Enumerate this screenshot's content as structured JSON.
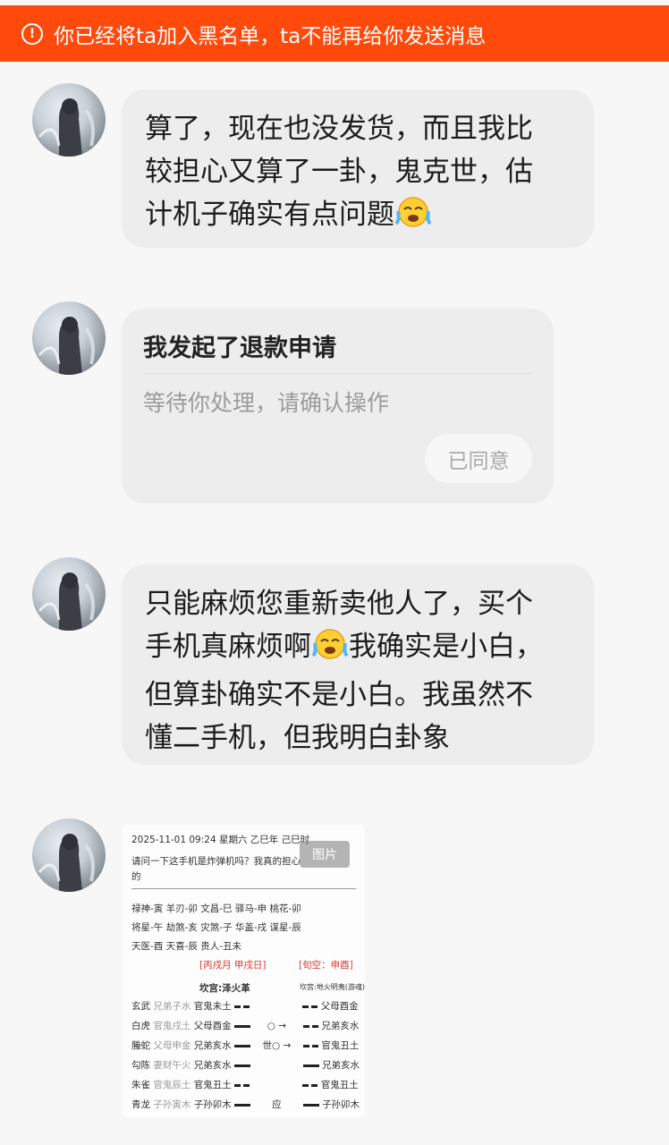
{
  "banner": {
    "text": "你已经将ta加入黑名单，ta不能再给你发送消息",
    "icon": "warning-circle-icon",
    "color": "#ff4a0c"
  },
  "messages": [
    {
      "type": "text",
      "lines": [
        "算了，现在也没发货，而且我比",
        "较担心又算了一卦，鬼克世，估",
        "计机子确实有点问题"
      ],
      "emoji": "crying-face"
    },
    {
      "type": "refund",
      "title": "我发起了退款申请",
      "subtitle": "等待你处理，请确认操作",
      "button": "已同意"
    },
    {
      "type": "text",
      "lines": [
        "只能麻烦您重新卖他人了，买个",
        "手机真麻烦啊",
        "我确实是小白，",
        "但算卦确实不是小白。我虽然不",
        "懂二手机，但我明白卦象"
      ],
      "emoji": "crying-face"
    },
    {
      "type": "image",
      "tag": "图片",
      "content": {
        "header": "2025-11-01 09:24  星期六  乙巳年  己巳时",
        "question1": "请问一下这手机是炸弹机吗？我真的担心",
        "question2": "的",
        "row1": "禄神-寅    羊刃-卯    文昌-巳    驿马-申    桃花-卯",
        "row2": "将星-午    劫煞-亥    灾煞-子    华盖-戌    谋星-辰",
        "row3": "天医-酉    天喜-辰    贵人-丑未",
        "month_day": "[丙戌月  甲戌日]",
        "void": "[旬空：申酉]",
        "gua_left": "坎宫:泽火革",
        "gua_right": "坎宫:地火明夷(游魂)",
        "lines": [
          {
            "god": "玄武",
            "fu": "兄弟子水",
            "main": "官鬼未土",
            "mark": "",
            "change": "父母酉金"
          },
          {
            "god": "白虎",
            "fu": "官鬼戌土",
            "main": "父母酉金",
            "mark": "○ →",
            "change": "兄弟亥水"
          },
          {
            "god": "螣蛇",
            "fu": "父母申金",
            "main": "兄弟亥水",
            "mark": "世○ →",
            "change": "官鬼丑土"
          },
          {
            "god": "勾陈",
            "fu": "妻财午火",
            "main": "兄弟亥水",
            "mark": "",
            "change": "兄弟亥水"
          },
          {
            "god": "朱雀",
            "fu": "官鬼辰土",
            "main": "官鬼丑土",
            "mark": "",
            "change": "官鬼丑土"
          },
          {
            "god": "青龙",
            "fu": "子孙寅木",
            "main": "子孙卯木",
            "mark": "应",
            "change": "子孙卯木"
          }
        ]
      }
    }
  ]
}
